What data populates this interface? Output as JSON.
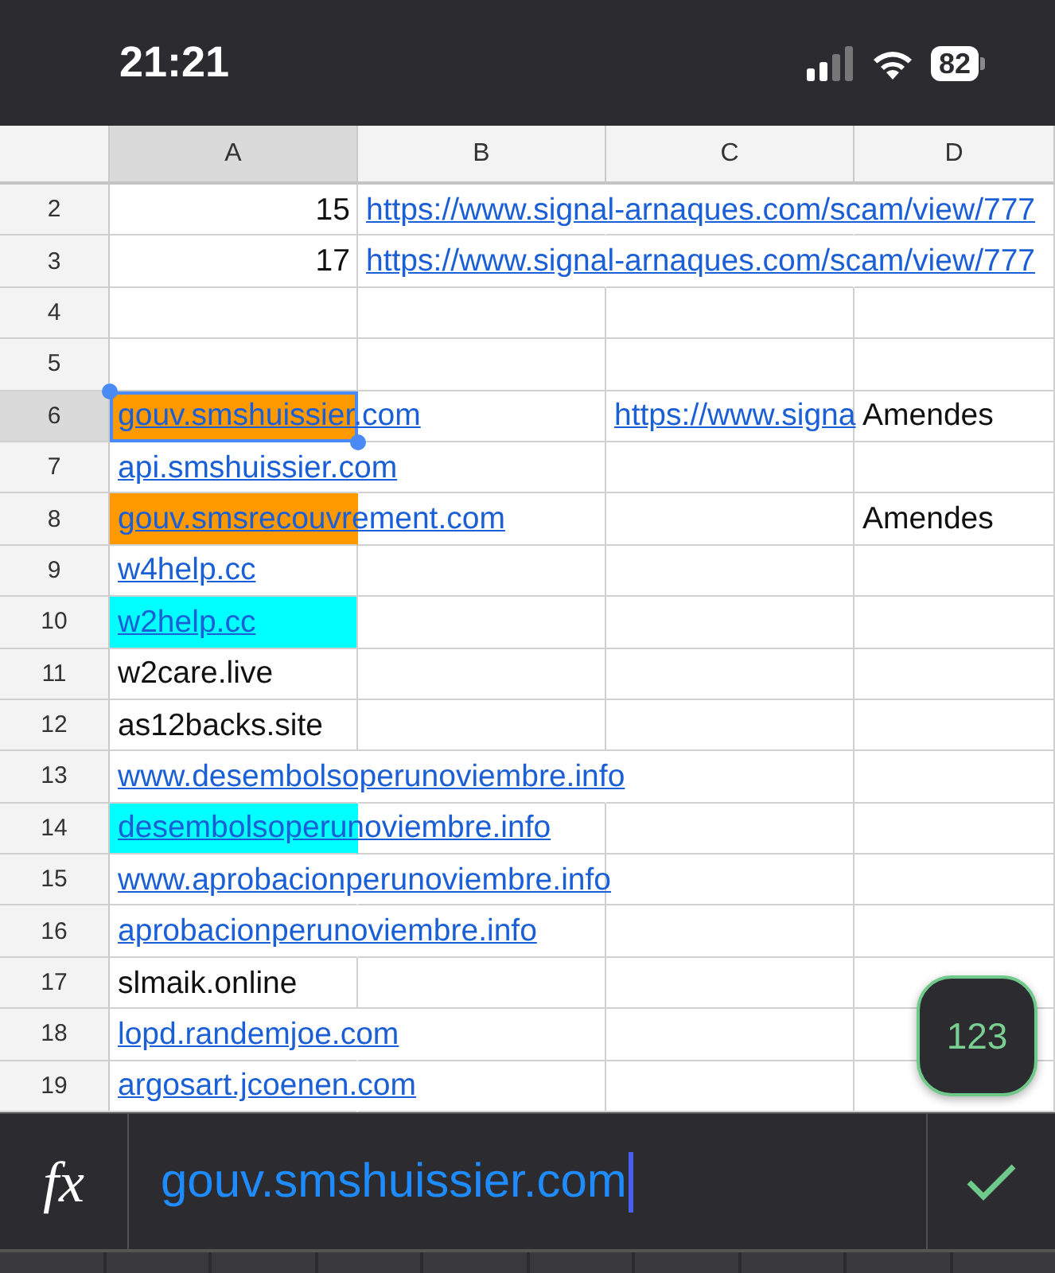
{
  "status_bar": {
    "time": "21:21",
    "battery": "82"
  },
  "columns": [
    {
      "label": "A",
      "selected": true
    },
    {
      "label": "B",
      "selected": false
    },
    {
      "label": "C",
      "selected": false
    },
    {
      "label": "D",
      "selected": false
    }
  ],
  "rows": [
    {
      "number": "2",
      "selected": false,
      "cells": [
        {
          "kind": "number",
          "text": "15"
        },
        {
          "kind": "link",
          "text": "https://www.signal-arnaques.com/scam/view/777"
        },
        null,
        null
      ]
    },
    {
      "number": "3",
      "selected": false,
      "cells": [
        {
          "kind": "number",
          "text": "17"
        },
        {
          "kind": "link",
          "text": "https://www.signal-arnaques.com/scam/view/777"
        },
        null,
        null
      ]
    },
    {
      "number": "4",
      "selected": false
    },
    {
      "number": "5",
      "selected": false
    },
    {
      "number": "6",
      "selected": true,
      "cells": [
        {
          "kind": "link",
          "text": "gouv.smshuissier.com",
          "color": "#ff9900"
        },
        null,
        {
          "kind": "link",
          "text": "https://www.signa"
        },
        {
          "kind": "text",
          "text": "Amendes"
        }
      ]
    },
    {
      "number": "7",
      "selected": false,
      "cells": [
        {
          "kind": "link",
          "text": "api.smshuissier.com"
        },
        null,
        null,
        null
      ]
    },
    {
      "number": "8",
      "selected": false,
      "cells": [
        {
          "kind": "link",
          "text": "gouv.smsrecouvrement.com",
          "color": "#ff9900"
        },
        null,
        null,
        {
          "kind": "text",
          "text": "Amendes"
        }
      ]
    },
    {
      "number": "9",
      "selected": false,
      "cells": [
        {
          "kind": "link",
          "text": "w4help.cc"
        },
        null,
        null,
        null
      ]
    },
    {
      "number": "10",
      "selected": false,
      "cells": [
        {
          "kind": "link",
          "text": "w2help.cc",
          "color": "#00ffff"
        },
        null,
        null,
        null
      ]
    },
    {
      "number": "11",
      "selected": false,
      "cells": [
        {
          "kind": "text",
          "text": "w2care.live"
        },
        null,
        null,
        null
      ]
    },
    {
      "number": "12",
      "selected": false,
      "cells": [
        {
          "kind": "text",
          "text": "as12backs.site"
        },
        null,
        null,
        null
      ]
    },
    {
      "number": "13",
      "selected": false,
      "cells": [
        {
          "kind": "link",
          "text": "www.desembolsoperunoviembre.info"
        },
        null,
        null,
        null
      ]
    },
    {
      "number": "14",
      "selected": false,
      "cells": [
        {
          "kind": "link",
          "text": "desembolsoperunoviembre.info",
          "color": "#00ffff"
        },
        null,
        null,
        null
      ]
    },
    {
      "number": "15",
      "selected": false,
      "cells": [
        {
          "kind": "link",
          "text": "www.aprobacionperunoviembre.info"
        },
        null,
        null,
        null
      ]
    },
    {
      "number": "16",
      "selected": false,
      "cells": [
        {
          "kind": "link",
          "text": "aprobacionperunoviembre.info"
        },
        null,
        null,
        null
      ]
    },
    {
      "number": "17",
      "selected": false,
      "cells": [
        {
          "kind": "text",
          "text": "slmaik.online"
        },
        null,
        null,
        null
      ]
    },
    {
      "number": "18",
      "selected": false,
      "cells": [
        {
          "kind": "link",
          "text": "lopd.randemjoe.com"
        },
        null,
        null,
        null
      ]
    },
    {
      "number": "19",
      "selected": false,
      "cells": [
        {
          "kind": "link",
          "text": "argosart.jcoenen.com"
        },
        null,
        null,
        null
      ]
    }
  ],
  "keypad_button": "123",
  "formula_bar": {
    "fx": "fx",
    "value": "gouv.smshuissier.com"
  }
}
